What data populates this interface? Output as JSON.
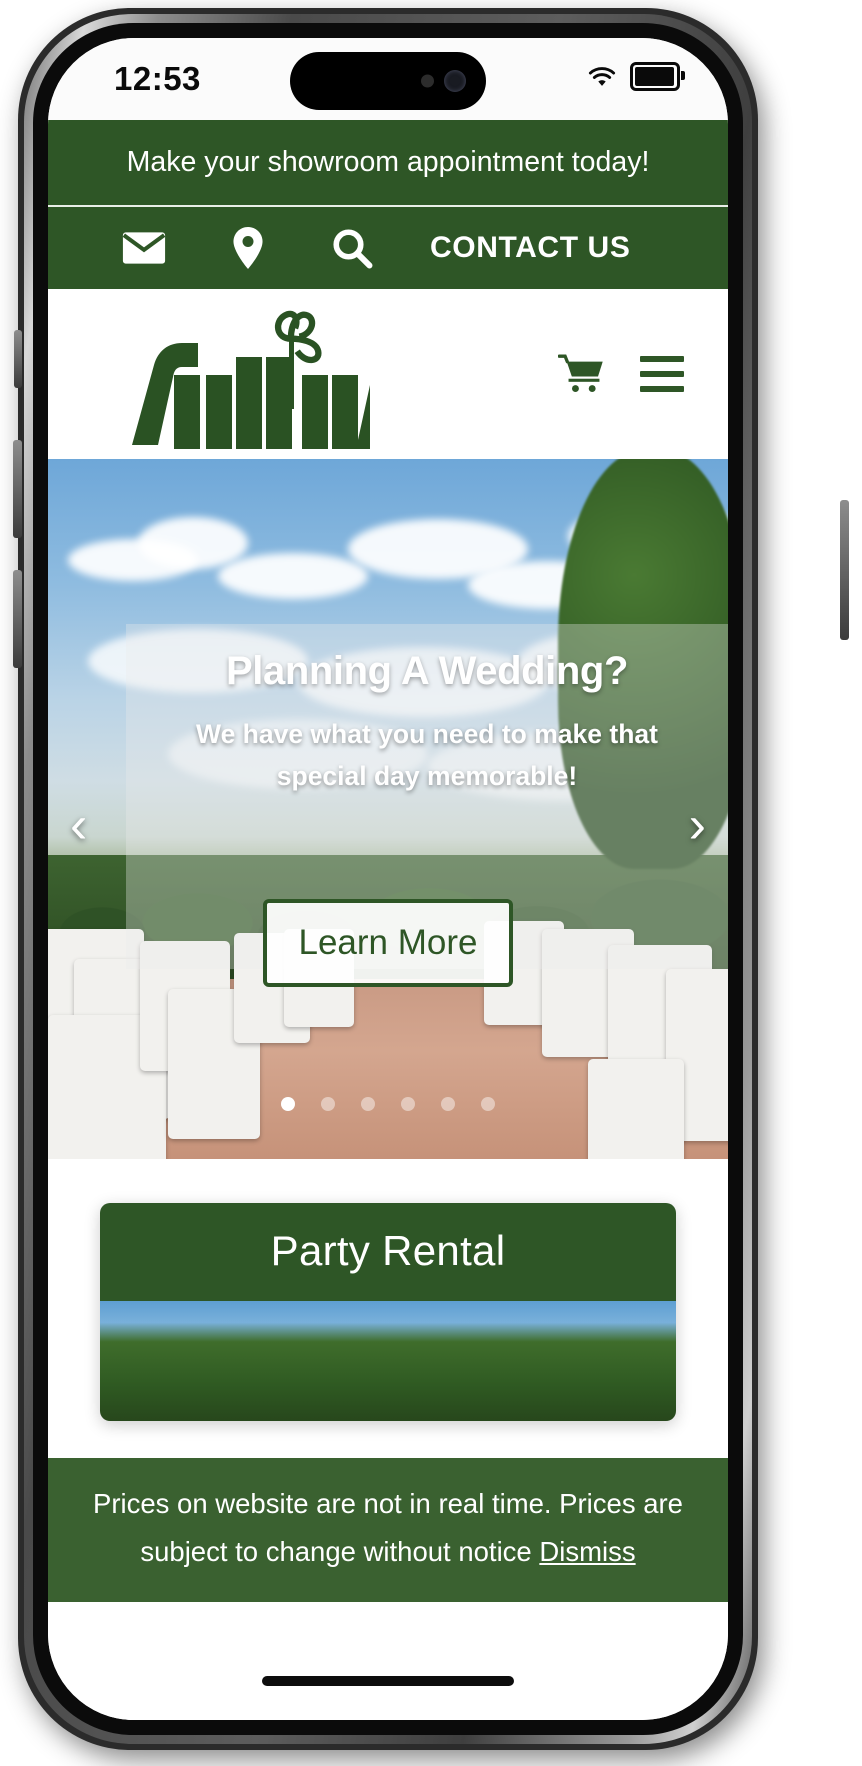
{
  "status_bar": {
    "time": "12:53",
    "wifi_icon": "wifi-icon",
    "battery_icon": "battery-icon"
  },
  "site": {
    "announcement": "Make your showroom appointment today!",
    "util_bar": {
      "email_icon": "envelope-icon",
      "location_icon": "map-pin-icon",
      "search_icon": "search-icon",
      "contact_label": "CONTACT US"
    },
    "header": {
      "logo_text": "Sully's",
      "logo_alt": "Sullys shamrock logo",
      "cart_icon": "shopping-cart-icon",
      "menu_icon": "hamburger-menu-icon"
    },
    "hero": {
      "title": "Planning A Wedding?",
      "subtitle": "We have what you need to make that special day memorable!",
      "cta_label": "Learn More",
      "prev_arrow": "‹",
      "next_arrow": "›",
      "slide_count": 6,
      "active_slide": 1
    },
    "cards": [
      {
        "title": "Party Rental"
      }
    ],
    "notice": {
      "text": "Prices on website are not in real time. Prices are subject to change without notice ",
      "dismiss_label": "Dismiss"
    }
  },
  "colors": {
    "brand_green": "#2e5626",
    "notice_green": "#3a6130",
    "white": "#ffffff"
  }
}
